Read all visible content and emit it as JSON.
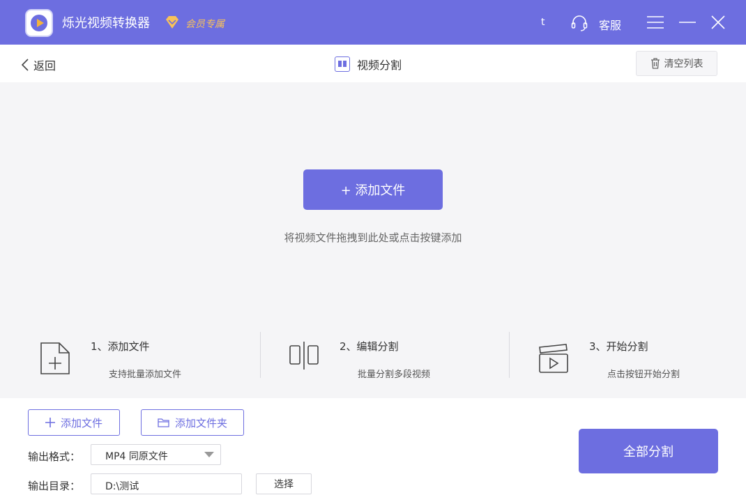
{
  "titlebar": {
    "app_title": "烁光视频转换器",
    "vip_badge": "会员专属",
    "user_name": "t",
    "service_label": "客服",
    "colors": {
      "accent": "#6d6ee0",
      "vip": "#f8c25a"
    }
  },
  "toolbar": {
    "back_label": "返回",
    "page_title": "视频分割",
    "clear_label": "清空列表"
  },
  "drop_area": {
    "add_button_label": "+ 添加文件",
    "hint": "将视频文件拖拽到此处或点击按键添加"
  },
  "steps": [
    {
      "icon": "add-file-icon",
      "title": "1、添加文件",
      "desc": "支持批量添加文件"
    },
    {
      "icon": "split-edit-icon",
      "title": "2、编辑分割",
      "desc": "批量分割多段视频"
    },
    {
      "icon": "clapper-play-icon",
      "title": "3、开始分割",
      "desc": "点击按钮开始分割"
    }
  ],
  "bottom": {
    "add_file_label": "添加文件",
    "add_folder_label": "添加文件夹",
    "output_format_label": "输出格式：",
    "output_format_value": "MP4 同原文件",
    "output_dir_label": "输出目录：",
    "output_dir_value": "D:\\测试",
    "choose_label": "选择",
    "split_all_label": "全部分割"
  }
}
